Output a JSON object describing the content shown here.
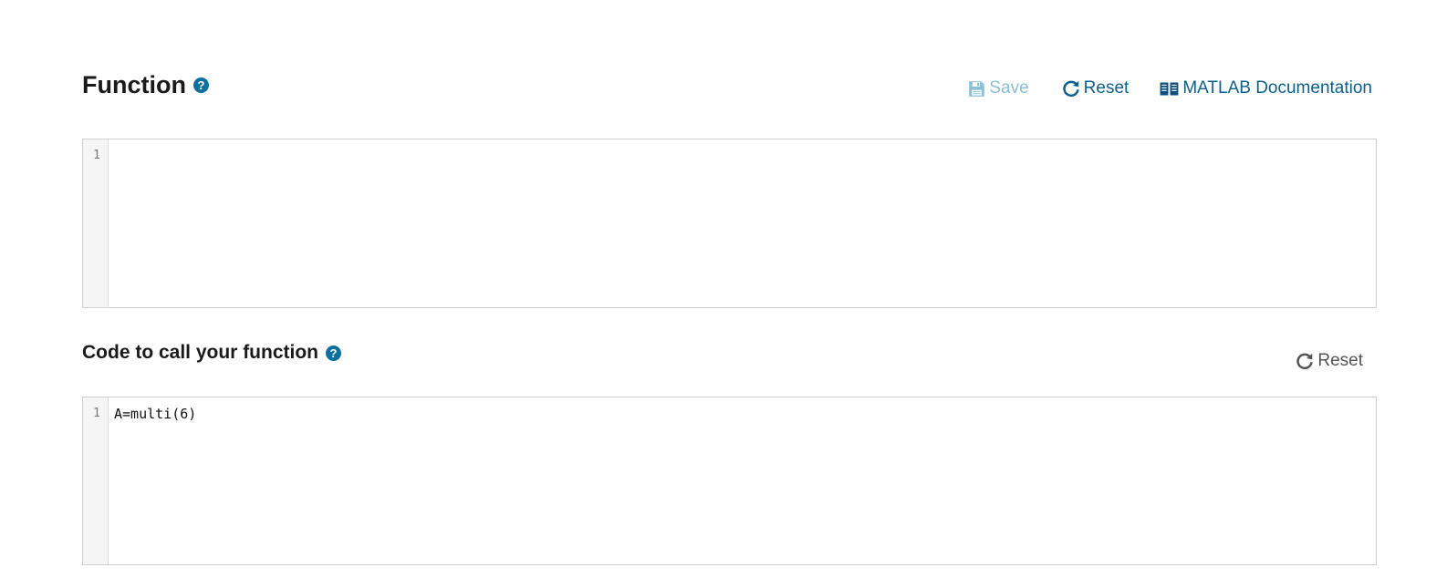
{
  "function_section": {
    "title": "Function",
    "help_glyph": "?",
    "toolbar": {
      "save_label": "Save",
      "reset_label": "Reset",
      "docs_label": "MATLAB Documentation"
    },
    "editor": {
      "line_numbers": [
        "1"
      ],
      "code": ""
    }
  },
  "call_section": {
    "title": "Code to call your function",
    "help_glyph": "?",
    "toolbar": {
      "reset_label": "Reset"
    },
    "editor": {
      "line_numbers": [
        "1"
      ],
      "code": "A=multi(6)"
    }
  },
  "colors": {
    "accent": "#0d6f9e",
    "link": "#0d5f8c",
    "disabled": "#8cc0d8",
    "neutral_reset": "#555555"
  },
  "icons": {
    "help": "question-circle-icon",
    "save": "floppy-disk-icon",
    "reset": "refresh-icon",
    "docs": "book-icon"
  }
}
